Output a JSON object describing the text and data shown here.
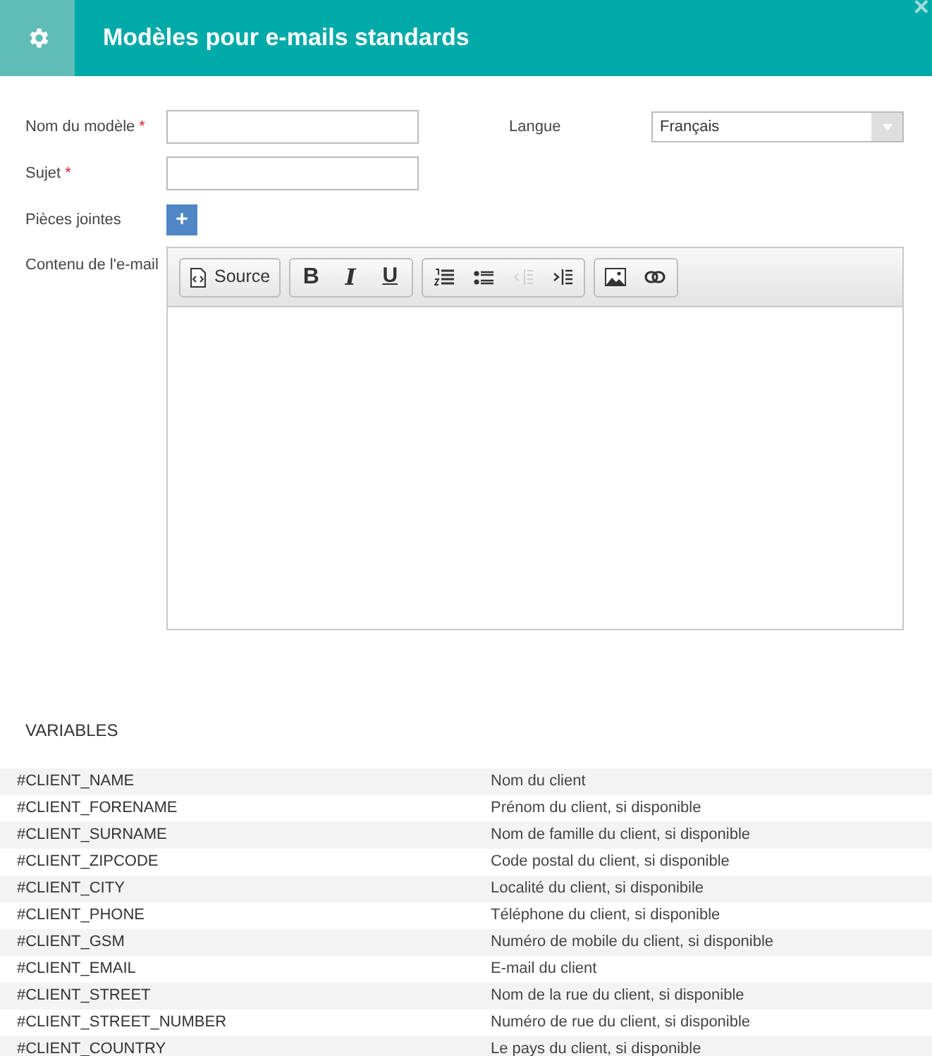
{
  "header": {
    "title": "Modèles pour e-mails standards",
    "close": "×"
  },
  "form": {
    "name_label": "Nom du modèle",
    "name_required_mark": "*",
    "subject_label": "Sujet",
    "subject_required_mark": "*",
    "attachments_label": "Pièces jointes",
    "attach_button": "+",
    "language_label": "Langue",
    "language_value": "Français",
    "content_label": "Contenu de l'e-mail"
  },
  "toolbar": [
    [
      {
        "kind": "source",
        "label": "Source",
        "disabled": false
      }
    ],
    [
      {
        "kind": "bold",
        "label": "B",
        "disabled": false
      },
      {
        "kind": "italic",
        "label": "I",
        "disabled": false
      },
      {
        "kind": "underline",
        "label": "U",
        "disabled": false
      }
    ],
    [
      {
        "kind": "numbered-list",
        "disabled": false
      },
      {
        "kind": "bulleted-list",
        "disabled": false
      },
      {
        "kind": "outdent",
        "disabled": true
      },
      {
        "kind": "indent",
        "disabled": false
      }
    ],
    [
      {
        "kind": "image",
        "disabled": false
      },
      {
        "kind": "link",
        "disabled": false
      }
    ]
  ],
  "variables": {
    "title": "VARIABLES",
    "rows": [
      {
        "name": "#CLIENT_NAME",
        "description": "Nom du client"
      },
      {
        "name": "#CLIENT_FORENAME",
        "description": "Prénom du client, si disponible"
      },
      {
        "name": "#CLIENT_SURNAME",
        "description": "Nom de famille du client, si disponible"
      },
      {
        "name": "#CLIENT_ZIPCODE",
        "description": "Code postal du client, si disponible"
      },
      {
        "name": "#CLIENT_CITY",
        "description": "Localité du client, si disponibile"
      },
      {
        "name": "#CLIENT_PHONE",
        "description": "Téléphone du client, si disponible"
      },
      {
        "name": "#CLIENT_GSM",
        "description": "Numéro de mobile du client, si disponible"
      },
      {
        "name": "#CLIENT_EMAIL",
        "description": "E-mail du client"
      },
      {
        "name": "#CLIENT_STREET",
        "description": "Nom de la rue du client, si disponible"
      },
      {
        "name": "#CLIENT_STREET_NUMBER",
        "description": "Numéro de rue du client, si disponible"
      },
      {
        "name": "#CLIENT_COUNTRY",
        "description": "Le pays du client, si disponible"
      }
    ]
  }
}
